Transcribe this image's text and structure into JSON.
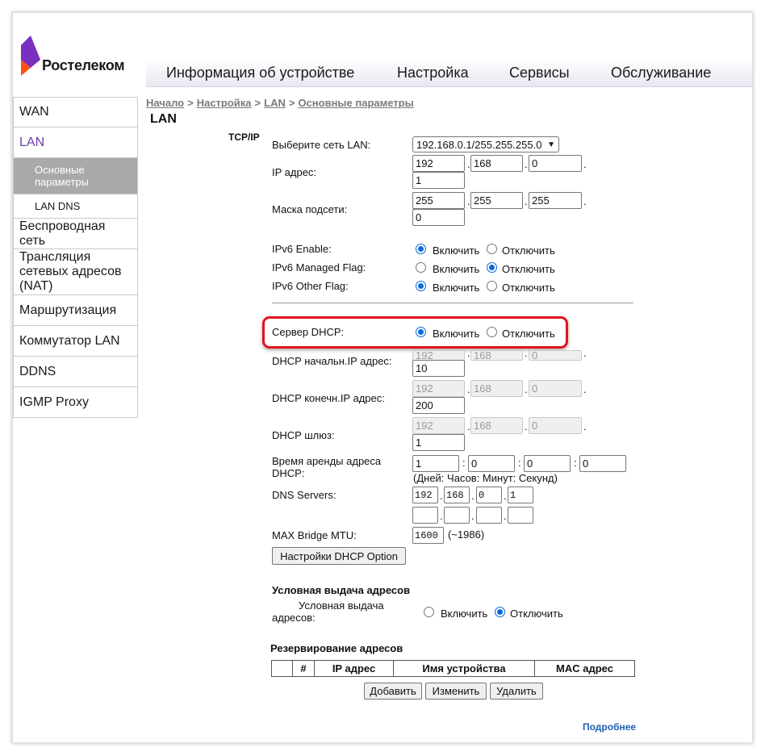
{
  "brand": {
    "name": "Ростелеком",
    "accent": "#7b2fbe",
    "accent2": "#ff4f12"
  },
  "nav": [
    "Информация об устройстве",
    "Настройка",
    "Сервисы",
    "Обслуживание"
  ],
  "sidebar": {
    "wan": "WAN",
    "lan": "LAN",
    "lan_basic": "Основные параметры",
    "lan_dns": "LAN DNS",
    "wireless": "Беспроводная сеть",
    "nat": "Трансляция сетевых адресов (NAT)",
    "routing": "Маршрутизация",
    "switch": "Коммутатор LAN",
    "ddns": "DDNS",
    "igmp": "IGMP Proxy"
  },
  "breadcrumb": [
    "Начало",
    "Настройка",
    "LAN",
    "Основные параметры"
  ],
  "title": "LAN",
  "tcpip": {
    "section": "TCP/IP",
    "lan_select_label": "Выберите сеть LAN:",
    "lan_select_value": "192.168.0.1/255.255.255.0",
    "ip_label": "IP адрес:",
    "ip": [
      "192",
      "168",
      "0",
      "1"
    ],
    "mask_label": "Маска подсети:",
    "mask": [
      "255",
      "255",
      "255",
      "0"
    ],
    "ipv6_enable_label": "IPv6 Enable:",
    "ipv6_managed_label": "IPv6 Managed Flag:",
    "ipv6_other_label": "IPv6 Other Flag:",
    "on": "Включить",
    "off": "Отключить"
  },
  "dhcp": {
    "server_label": "Сервер DHCP:",
    "start_label": "DHCP начальн.IP адрес:",
    "start": [
      "192",
      "168",
      "0",
      "10"
    ],
    "end_label": "DHCP конечн.IP адрес:",
    "end": [
      "192",
      "168",
      "0",
      "200"
    ],
    "gw_label": "DHCP шлюз:",
    "gw": [
      "192",
      "168",
      "0",
      "1"
    ],
    "lease_label": "Время аренды адреса DHCP:",
    "lease": [
      "1",
      "0",
      "0",
      "0"
    ],
    "lease_hint": "(Дней: Часов: Минут: Секунд)",
    "dns_label": "DNS Servers:",
    "dns1": [
      "192",
      "168",
      "0",
      "1"
    ],
    "dns2": [
      "",
      "",
      "",
      ""
    ],
    "mtu_label": "MAX Bridge MTU:",
    "mtu": "1600",
    "mtu_hint": "(~1986)",
    "option_button": "Настройки DHCP Option"
  },
  "conditional": {
    "section": "Условная выдача адресов",
    "label": "Условная выдача адресов:"
  },
  "reservation": {
    "section": "Резервирование адресов",
    "columns": [
      "",
      "#",
      "IP адрес",
      "Имя устройства",
      "MAC адрес"
    ],
    "add": "Добавить",
    "edit": "Изменить",
    "delete": "Удалить"
  },
  "more": "Подробнее"
}
